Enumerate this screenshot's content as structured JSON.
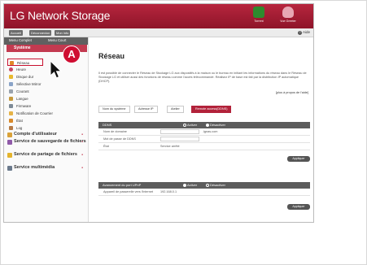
{
  "app": {
    "title": "LG Network Storage"
  },
  "header_icons": [
    {
      "label": "Torrent",
      "color": "#2e8b2e",
      "icon": "torrent-icon"
    },
    {
      "label": "Vue Greeter",
      "color": "#e7a7b3",
      "icon": "greeter-icon"
    }
  ],
  "toolbar": {
    "buttons": [
      "Accueil",
      "Déconnexion",
      "Mon info"
    ],
    "help": "Aide"
  },
  "sidebar": {
    "tabs": [
      "Menu Complet",
      "Menu Court"
    ],
    "section": "Système",
    "items": [
      "Réseau",
      "Heure",
      "Disque dur",
      "Sélective Mirror",
      "Courant",
      "Langue",
      "Firmware",
      "Notification de Courrier",
      "État",
      "Log"
    ],
    "groups": [
      "Compte d'utilisateur",
      "Service de sauvegarde de fichiers",
      "Service de partage de fichiers",
      "Service multimédia"
    ]
  },
  "callout": {
    "label": "A"
  },
  "page": {
    "title": "Réseau",
    "description": "Il est possible de connecter le Réseau de Stockage LG aux dispositifs à la maison ou le bureau en initiant les informations du réseau dans le Réseau de Stockage LG et utiliser aussi des fonctions de réseau comme l'accès télécommandé. Réalisez IP de base est fait par la distribution IP automatique (DHCP).",
    "about_link": "[plus à propos de l'aide]",
    "tabs": [
      "Nom du système",
      "Adresse IP",
      "Atelier",
      "Remote access(DDNS)"
    ]
  },
  "ddns": {
    "header": "DDNS",
    "activate": "Activer",
    "deactivate": "Désactiver",
    "rows": [
      {
        "label": "Nom de domaine",
        "suffix": ".lgnas.com"
      },
      {
        "label": "Mot de passe de DDNS"
      },
      {
        "label": "État",
        "value": "Service arrêté"
      }
    ],
    "apply": "Appliquer"
  },
  "upnp": {
    "header": "Avancement du port UPnP",
    "activate": "Activer",
    "deactivate": "Désactiver",
    "rows": [
      {
        "label": "Appareil de passerelle vers l'internet",
        "value": "192.168.0.1"
      }
    ],
    "apply": "Appliquer"
  }
}
